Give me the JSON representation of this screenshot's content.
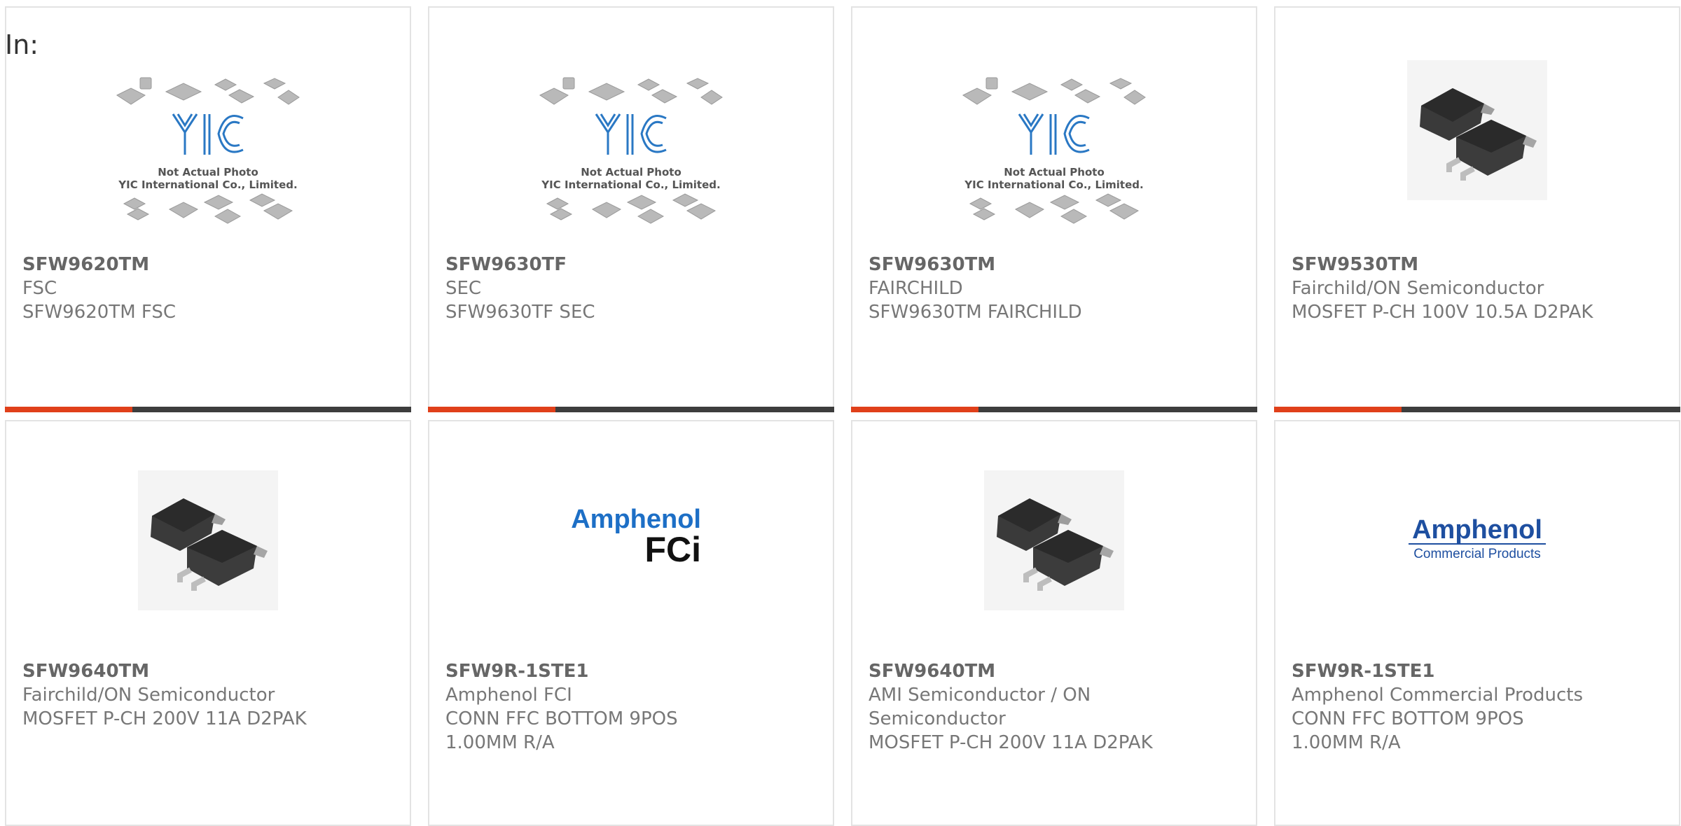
{
  "header": {
    "label": "In:"
  },
  "colors": {
    "accent": "#e0401a",
    "bar": "#3d3d3d",
    "border": "#e3e3e3"
  },
  "cards": [
    {
      "part": "SFW9620TM",
      "maker": "FSC",
      "desc": "SFW9620TM FSC",
      "image": "yic-placeholder",
      "img_text": {
        "line1": "Not Actual Photo",
        "line2": "YIC International Co., Limited."
      }
    },
    {
      "part": "SFW9630TF",
      "maker": "SEC",
      "desc": "SFW9630TF SEC",
      "image": "yic-placeholder",
      "img_text": {
        "line1": "Not Actual Photo",
        "line2": "YIC International Co., Limited."
      }
    },
    {
      "part": "SFW9630TM",
      "maker": "FAIRCHILD",
      "desc": "SFW9630TM FAIRCHILD",
      "image": "yic-placeholder",
      "img_text": {
        "line1": "Not Actual Photo",
        "line2": "YIC International Co., Limited."
      }
    },
    {
      "part": "SFW9530TM",
      "maker": "Fairchild/ON Semiconductor",
      "desc": "MOSFET P-CH 100V 10.5A D2PAK",
      "image": "d2pak-photo"
    },
    {
      "part": "SFW9640TM",
      "maker": "Fairchild/ON Semiconductor",
      "desc": "MOSFET P-CH 200V 11A D2PAK",
      "image": "d2pak-photo"
    },
    {
      "part": "SFW9R-1STE1",
      "maker": "Amphenol FCI",
      "desc": "CONN FFC BOTTOM 9POS",
      "desc2": "1.00MM R/A",
      "image": "amphenol-fci-logo",
      "logo_text": {
        "word": "Amphenol",
        "sub": "FCi"
      }
    },
    {
      "part": "SFW9640TM",
      "maker": "AMI Semiconductor / ON",
      "maker2": "Semiconductor",
      "desc": "MOSFET P-CH 200V 11A D2PAK",
      "image": "d2pak-photo"
    },
    {
      "part": "SFW9R-1STE1",
      "maker": "Amphenol Commercial Products",
      "desc": "CONN FFC BOTTOM 9POS",
      "desc2": "1.00MM R/A",
      "image": "amphenol-commercial-logo",
      "logo_text": {
        "word": "Amphenol",
        "sub": "Commercial Products"
      }
    }
  ]
}
